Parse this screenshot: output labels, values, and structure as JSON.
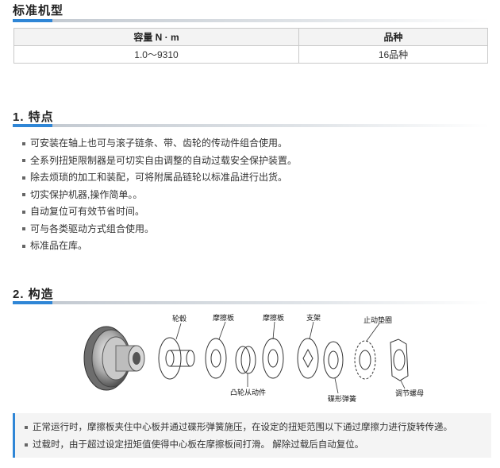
{
  "section1": {
    "title": "标准机型"
  },
  "spec_table": {
    "headers": [
      "容量 N · m",
      "品种"
    ],
    "rows": [
      [
        "1.0～9310",
        "16品种"
      ]
    ]
  },
  "section2": {
    "title": "1.  特点",
    "items": [
      "可安装在轴上也可与滚子链条、带、齿轮的传动件组合使用。",
      "全系列扭矩限制器是可切实自由调整的自动过载安全保护装置。",
      "除去烦琐的加工和装配，可将附属品链轮以标准品进行出货。",
      "切实保护机器,操作简单。。",
      "自动复位可有效节省时间。",
      "可与各类驱动方式组合使用。",
      "标准品在库。"
    ]
  },
  "section3": {
    "title": "2.  构造",
    "labels": {
      "hub": "轮毂",
      "friction1": "摩擦板",
      "friction2": "摩擦板",
      "bracket": "支架",
      "stop_washer": "止动垫圈",
      "cam_follower": "凸轮从动件",
      "disc_spring": "碟形弹簧",
      "adjust_nut": "调节螺母"
    }
  },
  "notes": [
    "正常运行时，摩擦板夹住中心板并通过碟形弹簧施压，在设定的扭矩范围以下通过摩擦力进行旋转传递。",
    "过载时，由于超过设定扭矩值使得中心板在摩擦板间打滑。 解除过载后自动复位。"
  ]
}
